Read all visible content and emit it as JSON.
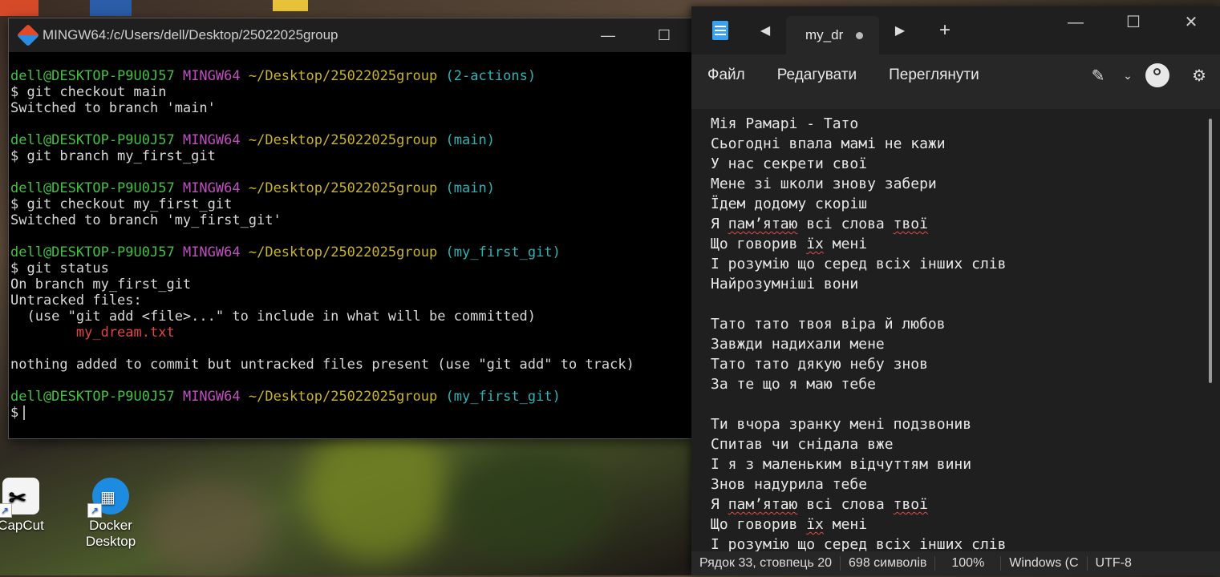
{
  "terminal": {
    "title": "MINGW64:/c/Users/dell/Desktop/25022025group",
    "user_host": "dell@DESKTOP-P9U0J57",
    "shell": "MINGW64",
    "path": "~/Desktop/25022025group",
    "branches": [
      "(2-actions)",
      "(main)",
      "(main)",
      "(my_first_git)",
      "(my_first_git)"
    ],
    "commands": [
      "$ git checkout main",
      "$ git branch my_first_git",
      "$ git checkout my_first_git",
      "$ git status",
      "$"
    ],
    "outputs": {
      "o1": "Switched to branch 'main'",
      "o3": "Switched to branch 'my_first_git'",
      "o4a": "On branch my_first_git",
      "o4b": "Untracked files:",
      "o4c": "  (use \"git add <file>...\" to include in what will be committed)",
      "o4d": "        my_dream.txt",
      "o4e": "nothing added to commit but untracked files present (use \"git add\" to track)"
    }
  },
  "notepad": {
    "tab_title": "my_dr",
    "menu": [
      "Файл",
      "Редагувати",
      "Переглянути"
    ],
    "lines": [
      "Мія Рамарі - Тато",
      "Сьогодні впала мамі не кажи",
      "У нас секрети свої",
      "Мене зі школи знову забери",
      "Їдем додому скоріш",
      "Я пам’ятаю всі слова твої",
      "Що говорив їх мені",
      "І розумію що серед всіх інших слів",
      "Найрозумніші вони",
      "",
      "Тато тато твоя віра й любов",
      "Завжди надихали мене",
      "Тато тато дякую небу знов",
      "За те що я маю тебе",
      "",
      "Ти вчора зранку мені подзвонив",
      "Спитав чи снідала вже",
      "І я з маленьким відчуттям вини",
      "Знов надурила тебе",
      "Я пам’ятаю всі слова твої",
      "Що говорив їх мені",
      "І розумію що серед всіх інших слів"
    ],
    "status": {
      "position": "Рядок 33, стовпець 20",
      "chars": "698 символів",
      "zoom": "100%",
      "eol": "Windows (C",
      "encoding": "UTF-8"
    }
  },
  "desktop": {
    "icons": [
      {
        "label": "CapCut"
      },
      {
        "label": "Docker\nDesktop"
      }
    ]
  }
}
